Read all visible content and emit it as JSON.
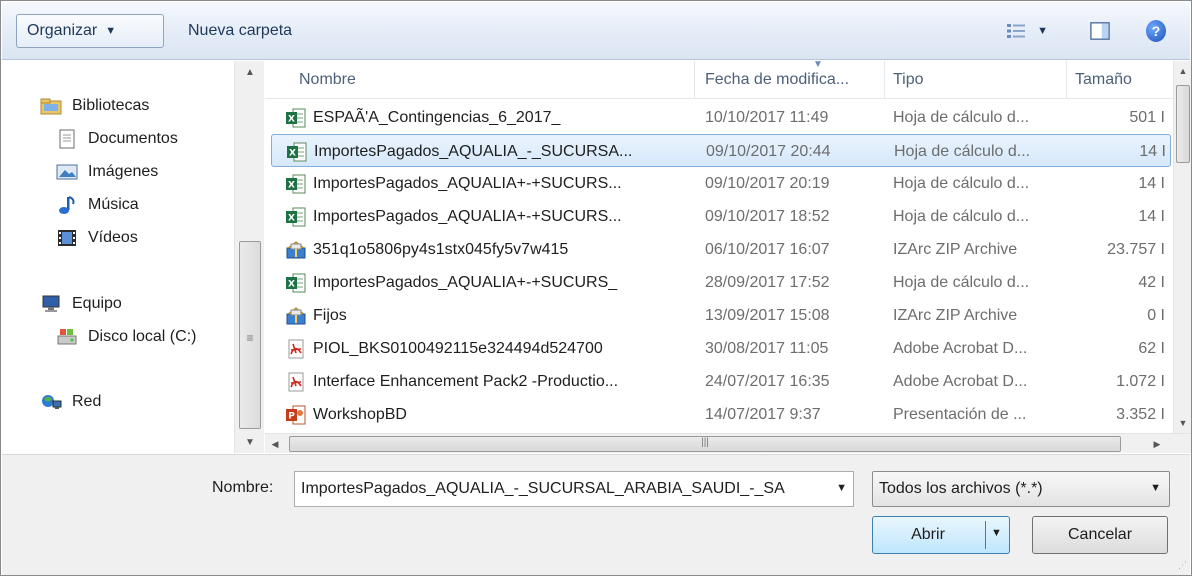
{
  "toolbar": {
    "organizar": "Organizar",
    "nueva_carpeta": "Nueva carpeta",
    "help": "?"
  },
  "nav": {
    "bibliotecas": "Bibliotecas",
    "documentos": "Documentos",
    "imagenes": "Imágenes",
    "musica": "Música",
    "videos": "Vídeos",
    "equipo": "Equipo",
    "disco": "Disco local (C:)",
    "red": "Red"
  },
  "columns": {
    "name": "Nombre",
    "date": "Fecha de modifica...",
    "type": "Tipo",
    "size": "Tamaño"
  },
  "files": [
    {
      "name": "ESPAÃ'A_Contingencias_6_2017_",
      "date": "10/10/2017 11:49",
      "type": "Hoja de cálculo d...",
      "size": "501 I",
      "icon": "excel-icon"
    },
    {
      "name": "ImportesPagados_AQUALIA_-_SUCURSA...",
      "date": "09/10/2017 20:44",
      "type": "Hoja de cálculo d...",
      "size": "14 I",
      "icon": "excel-icon"
    },
    {
      "name": "ImportesPagados_AQUALIA+-+SUCURS...",
      "date": "09/10/2017 20:19",
      "type": "Hoja de cálculo d...",
      "size": "14 I",
      "icon": "excel-icon"
    },
    {
      "name": "ImportesPagados_AQUALIA+-+SUCURS...",
      "date": "09/10/2017 18:52",
      "type": "Hoja de cálculo d...",
      "size": "14 I",
      "icon": "excel-icon"
    },
    {
      "name": "351q1o5806py4s1stx045fy5v7w415",
      "date": "06/10/2017 16:07",
      "type": "IZArc ZIP Archive",
      "size": "23.757 I",
      "icon": "zip-archive-icon"
    },
    {
      "name": "ImportesPagados_AQUALIA+-+SUCURS_",
      "date": "28/09/2017 17:52",
      "type": "Hoja de cálculo d...",
      "size": "42 I",
      "icon": "excel-icon"
    },
    {
      "name": "Fijos",
      "date": "13/09/2017 15:08",
      "type": "IZArc ZIP Archive",
      "size": "0 I",
      "icon": "zip-archive-icon"
    },
    {
      "name": "PIOL_BKS0100492115e324494d524700",
      "date": "30/08/2017 11:05",
      "type": "Adobe Acrobat D...",
      "size": "62 I",
      "icon": "pdf-icon"
    },
    {
      "name": "Interface Enhancement Pack2 -Productio...",
      "date": "24/07/2017 16:35",
      "type": "Adobe Acrobat D...",
      "size": "1.072 I",
      "icon": "pdf-icon"
    },
    {
      "name": "WorkshopBD",
      "date": "14/07/2017 9:37",
      "type": "Presentación de ...",
      "size": "3.352 I",
      "icon": "powerpoint-icon"
    }
  ],
  "selected_index": 1,
  "bottom": {
    "nombre_label": "Nombre:",
    "filename_value": "ImportesPagados_AQUALIA_-_SUCURSAL_ARABIA_SAUDI_-_SA",
    "filter_value": "Todos los archivos (*.*)",
    "abrir": "Abrir",
    "cancelar": "Cancelar"
  },
  "scroll_grip": "|||",
  "nav_grip": "≡"
}
